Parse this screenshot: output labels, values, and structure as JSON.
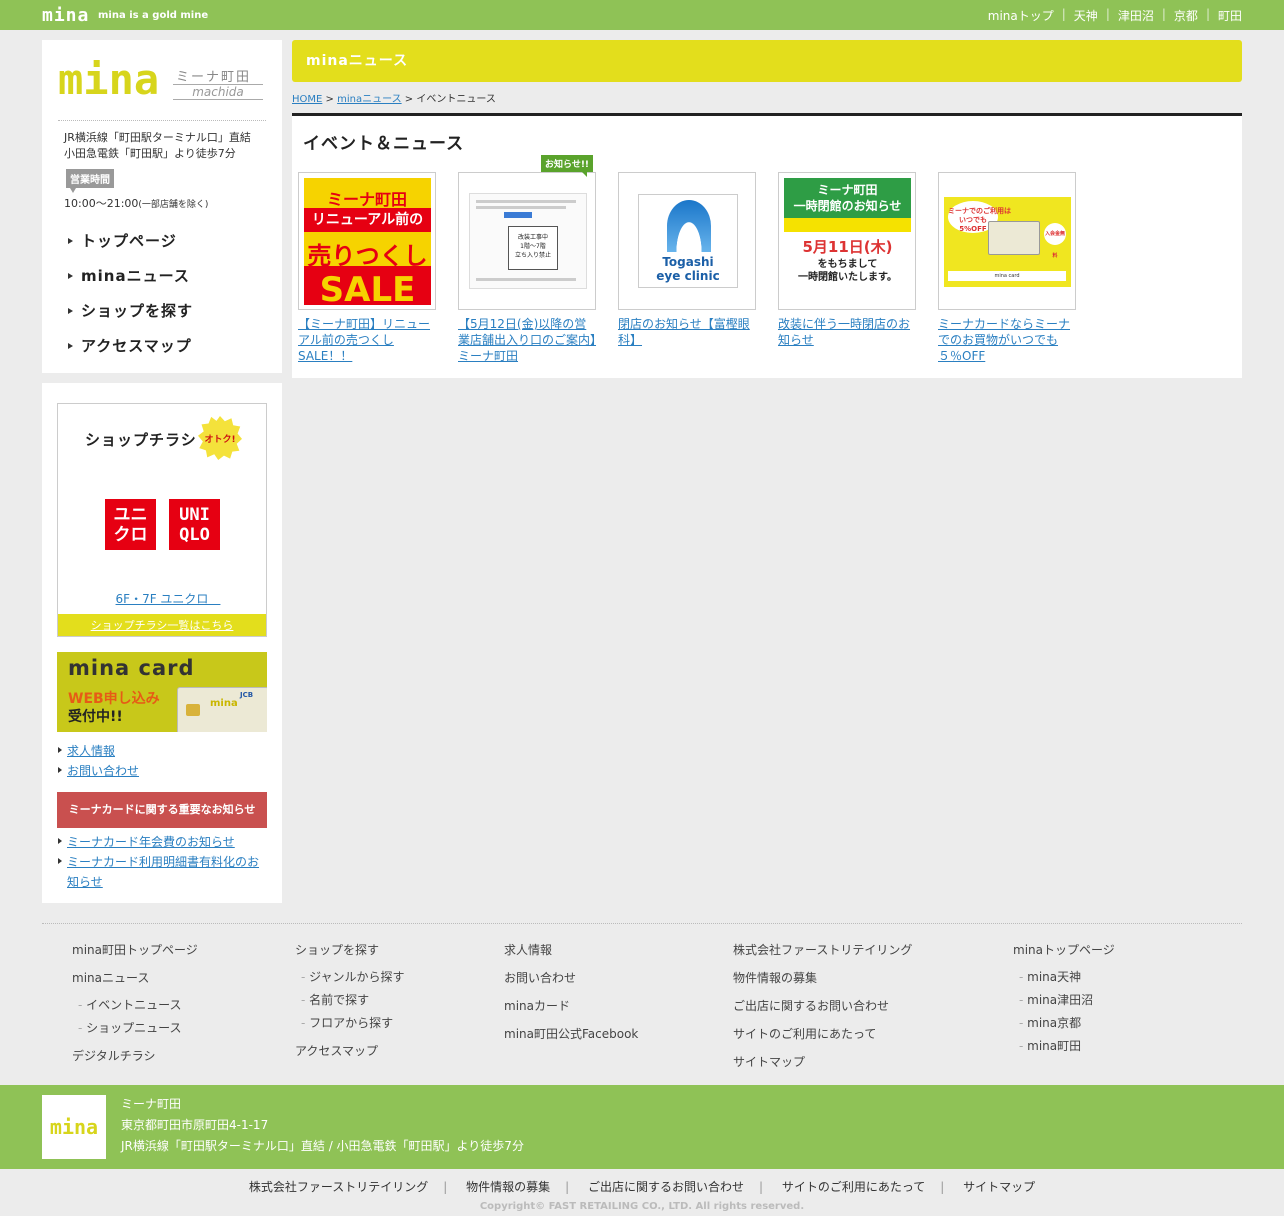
{
  "topbar": {
    "logo": "mina",
    "tagline": "mina is a gold mine",
    "nav": [
      "minaトップ",
      "天神",
      "津田沼",
      "京都",
      "町田"
    ]
  },
  "brand": {
    "logo": "mina",
    "name_jp": "ミーナ町田",
    "name_en": "machida"
  },
  "store_info": {
    "access_line1": "JR横浜線「町田駅ターミナル口」直結",
    "access_line2": "小田急電鉄「町田駅」より徒歩7分",
    "hours_label": "営業時間",
    "hours": "10:00～21:00",
    "hours_note": "(一部店舗を除く)"
  },
  "side_nav": [
    "トップページ",
    "minaニュース",
    "ショップを探す",
    "アクセスマップ"
  ],
  "shop_flyer": {
    "title": "ショップチラシ",
    "badge": "オトク!",
    "uniqlo_left": "ユニ\nクロ",
    "uniqlo_right": "UNI\nQLO",
    "link": "6F・7F ユニクロ　",
    "list_link": "ショップチラシ一覧はこちら"
  },
  "card_banner": {
    "title": "mina card",
    "web": "WEB申し込み",
    "sub": "受付中!!",
    "card_logo": "mina",
    "card_brand": "JCB"
  },
  "side_links": [
    "求人情報",
    "お問い合わせ"
  ],
  "notice": {
    "title": "ミーナカードに関する重要なお知らせ",
    "links": [
      "ミーナカード年会費のお知らせ",
      "ミーナカード利用明細書有料化のお知らせ"
    ]
  },
  "main": {
    "header": "minaニュース",
    "breadcrumb": {
      "home": "HOME",
      "news": "minaニュース",
      "sep": ">",
      "current": "イベントニュース"
    },
    "section_title": "イベント＆ニュース",
    "items": [
      {
        "title": "【ミーナ町田】リニューアル前の売つくしSALE！！",
        "thumb": {
          "a": "ミーナ町田",
          "b": "リニューアル前の",
          "c": "売りつくし",
          "d": "SALE"
        }
      },
      {
        "title": "【5月12日(金)以降の営業店舗出入り口のご案内】ミーナ町田",
        "badge": "お知らせ!!",
        "thumb": {
          "box": "改装工事中\n1階～7階\n立ち入り禁止"
        }
      },
      {
        "title": "閉店のお知らせ【富樫眼科】",
        "thumb": {
          "logo": "Togashi\neye clinic"
        }
      },
      {
        "title": "改装に伴う一時閉店のお知らせ",
        "thumb": {
          "g": "ミーナ町田\n一時閉館のお知らせ",
          "big": "5月11日(木)",
          "big2": "をもちまして\n一時閉館いたします。"
        }
      },
      {
        "title": "ミーナカードならミーナでのお買物がいつでも５％OFF",
        "thumb": {
          "bubble": "ミーナでのご利用は\nいつでも\n5%OFF",
          "round": "入会金無料",
          "card": "mina card"
        }
      }
    ]
  },
  "footer": {
    "col1": {
      "items": [
        "mina町田トップページ",
        "minaニュース"
      ],
      "sub": [
        "イベントニュース",
        "ショップニュース"
      ],
      "last": "デジタルチラシ"
    },
    "col2": {
      "first": "ショップを探す",
      "sub": [
        "ジャンルから探す",
        "名前で探す",
        "フロアから探す"
      ],
      "last": "アクセスマップ"
    },
    "col3": [
      "求人情報",
      "お問い合わせ",
      "minaカード",
      "mina町田公式Facebook"
    ],
    "col4": [
      "株式会社ファーストリテイリング",
      "物件情報の募集",
      "ご出店に関するお問い合わせ",
      "サイトのご利用にあたって",
      "サイトマップ"
    ],
    "col5": {
      "first": "minaトップページ",
      "sub": [
        "mina天神",
        "mina津田沼",
        "mina京都",
        "mina町田"
      ]
    },
    "info": {
      "logo": "mina",
      "name": "ミーナ町田",
      "address": "東京都町田市原町田4-1-17",
      "access": "JR横浜線「町田駅ターミナル口」直結 / 小田急電鉄「町田駅」より徒歩7分"
    },
    "bottom_links": [
      "株式会社ファーストリテイリング",
      "物件情報の募集",
      "ご出店に関するお問い合わせ",
      "サイトのご利用にあたって",
      "サイトマップ"
    ],
    "copyright": "Copyright© FAST RETAILING CO., LTD. All rights reserved."
  },
  "colors": {
    "green": "#8fc256",
    "yellow": "#e3de1c",
    "red": "#c9504f",
    "link": "#2a7fc1"
  }
}
